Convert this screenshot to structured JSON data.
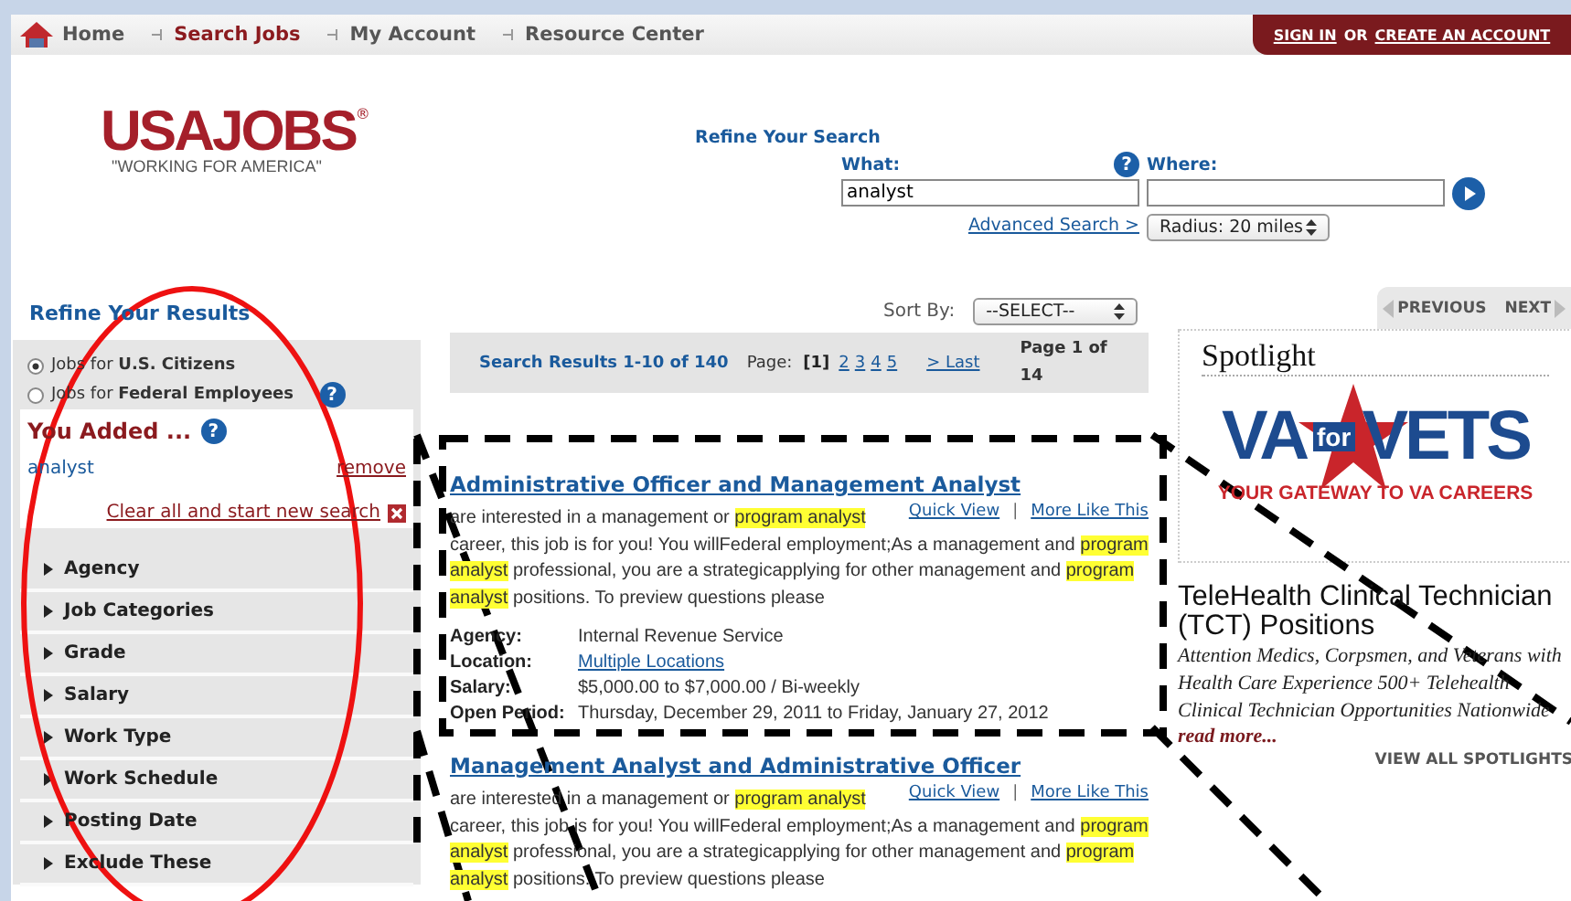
{
  "nav": {
    "items": [
      {
        "label": "Home",
        "kind": "home",
        "selected": false
      },
      {
        "label": "Search Jobs",
        "kind": "link",
        "selected": true
      },
      {
        "label": "My Account",
        "kind": "link",
        "selected": false
      },
      {
        "label": "Resource Center",
        "kind": "link",
        "selected": false
      }
    ],
    "account": {
      "sign_in": "SIGN IN",
      "or": "OR",
      "create": "CREATE AN ACCOUNT"
    }
  },
  "logo": {
    "name": "USAJOBS",
    "mark": "®",
    "tagline": "\"WORKING FOR AMERICA\""
  },
  "refine_search": {
    "title": "Refine Your Search",
    "what": {
      "label": "What:",
      "help": "?",
      "value": "analyst"
    },
    "where": {
      "label": "Where:"
    },
    "advanced": "Advanced Search >",
    "radius": "Radius: 20 miles"
  },
  "sidebar": {
    "title": "Refine Your Results",
    "audiences": [
      {
        "label": "Jobs for **U.S. Citizens**",
        "selected": true
      },
      {
        "label": "Jobs for **Federal Employees**",
        "selected": false
      }
    ],
    "audience_help": "?",
    "added": {
      "title": "You Added ...",
      "help": "?",
      "items": [
        {
          "term": "analyst",
          "remove": "remove"
        }
      ],
      "clear": "Clear all and start new search"
    },
    "filters": [
      {
        "label": "Agency",
        "expanded": false
      },
      {
        "label": "Job Categories",
        "expanded": false
      },
      {
        "label": "Grade",
        "expanded": false
      },
      {
        "label": "Salary",
        "expanded": false
      },
      {
        "label": "Work Type",
        "expanded": false
      },
      {
        "label": "Work Schedule",
        "expanded": false
      },
      {
        "label": "Posting Date",
        "expanded": false
      },
      {
        "label": "Exclude These",
        "expanded": false
      }
    ]
  },
  "results": {
    "sort": {
      "label": "Sort By:",
      "value": "--SELECT--"
    },
    "summary": "Search Results 1-10 of 140",
    "page_label": "Page:",
    "pages": [
      {
        "label": "[1]",
        "selected": true
      },
      {
        "label": "2",
        "selected": false
      },
      {
        "label": "3",
        "selected": false
      },
      {
        "label": "4",
        "selected": false
      },
      {
        "label": "5",
        "selected": false
      }
    ],
    "last": "> Last",
    "page_of": "Page 1 of 14",
    "jobs": [
      {
        "title": "Administrative Officer and Management Analyst",
        "quick_view": "Quick View",
        "separator": "|",
        "more_like": "More Like This",
        "description": [
          {
            "text": "are interested in a management or ",
            "highlight": false
          },
          {
            "text": "program analyst",
            "highlight": true
          },
          {
            "text": " career, this job is for you! You willFederal employment;As a management and ",
            "highlight": false
          },
          {
            "text": "program analyst",
            "highlight": true
          },
          {
            "text": " professional, you are a strategicapplying for other management and ",
            "highlight": false
          },
          {
            "text": "program analyst",
            "highlight": true
          },
          {
            "text": " positions. To preview questions please",
            "highlight": false
          }
        ],
        "details": [
          {
            "label": "Agency:",
            "value": "Internal Revenue Service",
            "kind": "text"
          },
          {
            "label": "Location:",
            "value": "Multiple Locations",
            "kind": "link"
          },
          {
            "label": "Salary:",
            "value": "$5,000.00 to $7,000.00 / Bi-weekly",
            "kind": "text"
          },
          {
            "label": "Open Period:",
            "value": "Thursday, December 29, 2011 to Friday, January 27, 2012",
            "kind": "text"
          }
        ]
      },
      {
        "title": "Management Analyst and Administrative Officer",
        "quick_view": "Quick View",
        "separator": "|",
        "more_like": "More Like This",
        "description": [
          {
            "text": "are interested in a management or ",
            "highlight": false
          },
          {
            "text": "program analyst",
            "highlight": true
          },
          {
            "text": " career, this job is for you! You willFederal employment;As a management and ",
            "highlight": false
          },
          {
            "text": "program analyst",
            "highlight": true
          },
          {
            "text": " professional, you are a strategicapplying for other management and ",
            "highlight": false
          },
          {
            "text": "program analyst",
            "highlight": true
          },
          {
            "text": " positions. To preview questions please",
            "highlight": false
          }
        ]
      }
    ]
  },
  "spotlight": {
    "previous": "PREVIOUS",
    "next": "NEXT",
    "title": "Spotlight",
    "logo": {
      "left": "VA",
      "middle": "for",
      "right": "VETS",
      "tagline": "YOUR GATEWAY TO VA CAREERS"
    },
    "headline": "TeleHealth Clinical Technician (TCT) Positions",
    "text": "Attention Medics, Corpsmen, and Veterans with Health Care Experience 500+ Telehealth Clinical Technician Opportunities Nationwide",
    "read_more": "read more...",
    "view_all": "VIEW ALL SPOTLIGHTS"
  },
  "annotations": [
    {
      "kind": "ellipse"
    },
    {
      "kind": "dashed_box"
    },
    {
      "kind": "dashed_line"
    },
    {
      "kind": "dashed_line"
    },
    {
      "kind": "dashed_line"
    },
    {
      "kind": "dashed_line"
    },
    {
      "kind": "dashed_line"
    }
  ]
}
